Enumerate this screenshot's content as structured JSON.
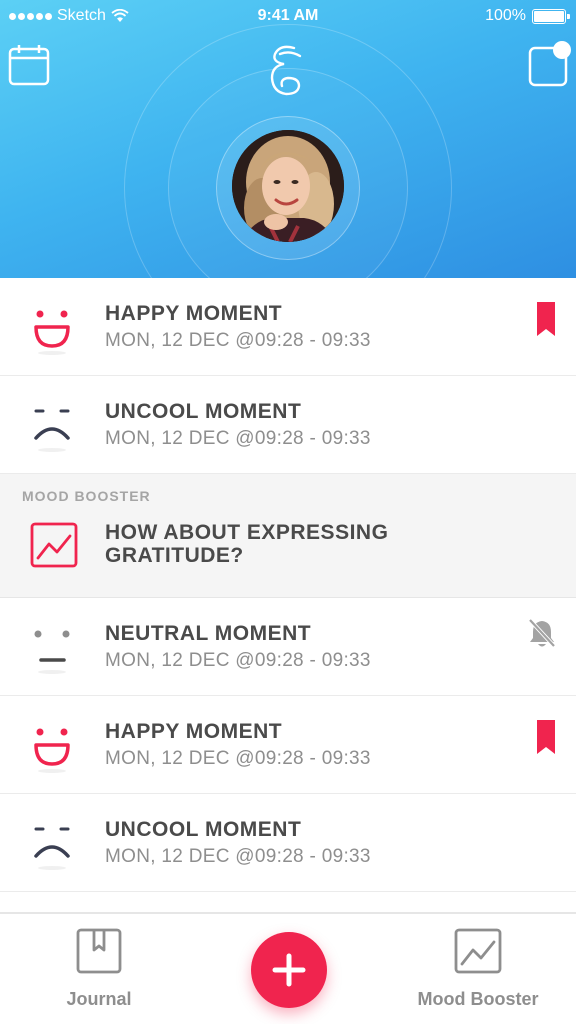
{
  "status_bar": {
    "carrier": "Sketch",
    "time": "9:41 AM",
    "battery": "100%"
  },
  "header": {
    "left_icon": "calendar-icon",
    "logo_icon": "app-logo-swirl-icon",
    "right_icon": "notification-square-icon",
    "avatar_alt": "User profile photo"
  },
  "moments": [
    {
      "title": "HAPPY MOMENT",
      "subtitle": "MON, 12 DEC @09:28 - 09:33",
      "mood": "happy",
      "indicator": "bookmark-icon"
    },
    {
      "title": "UNCOOL MOMENT",
      "subtitle": "MON, 12 DEC @09:28 - 09:33",
      "mood": "sad",
      "indicator": ""
    },
    {
      "title": "NEUTRAL MOMENT",
      "subtitle": "MON, 12 DEC @09:28 - 09:33",
      "mood": "neutral",
      "indicator": "bell-muted-icon"
    },
    {
      "title": "HAPPY MOMENT",
      "subtitle": "MON, 12 DEC @09:28 - 09:33",
      "mood": "happy",
      "indicator": "bookmark-icon"
    },
    {
      "title": "UNCOOL MOMENT",
      "subtitle": "MON, 12 DEC @09:28 - 09:33",
      "mood": "sad",
      "indicator": ""
    }
  ],
  "booster_card": {
    "label": "MOOD BOOSTER",
    "title": "HOW ABOUT EXPRESSING GRATITUDE?",
    "icon": "chart-trend-icon"
  },
  "tabbar": {
    "journal_label": "Journal",
    "add_icon": "plus-icon",
    "booster_label": "Mood Booster"
  },
  "colors": {
    "accent": "#f0244e",
    "header_gradient_start": "#5cd0f5",
    "header_gradient_end": "#2e8fe2",
    "text_primary": "#4a4a4a",
    "text_secondary": "#8e8e8e"
  }
}
